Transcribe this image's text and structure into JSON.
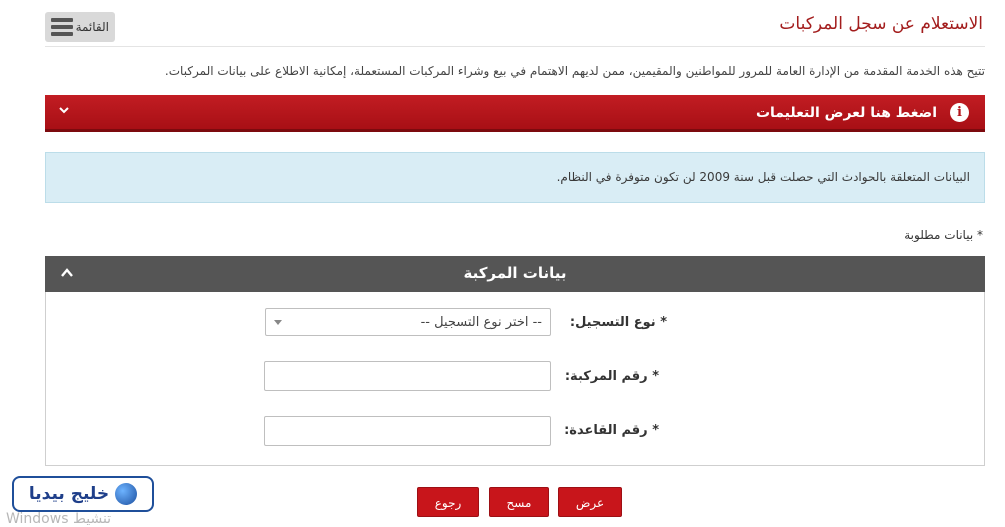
{
  "header": {
    "title": "الاستعلام عن سجل المركبات",
    "menu_label": "القائمة"
  },
  "description": "تتيح هذه الخدمة المقدمة من الإدارة العامة للمرور للمواطنين والمقيمين، ممن لديهم الاهتمام في بيع وشراء المركبات المستعملة، إمكانية الاطلاع على بيانات المركبات.",
  "instructions": {
    "label": "اضغط هنا لعرض التعليمات",
    "info_icon": "i"
  },
  "notice": "البيانات المتعلقة بالحوادث التي حصلت قبل سنة 2009 لن تكون متوفرة في النظام.",
  "required_note": "* بيانات مطلوبة",
  "vehicle_section": {
    "title": "بيانات المركبة",
    "registration_type": {
      "label": "* نوع التسجيل:",
      "selected": "-- اختر نوع التسجيل --"
    },
    "vehicle_number": {
      "label": "* رقم المركبة:",
      "value": ""
    },
    "base_number": {
      "label": "* رقم القاعدة:",
      "value": ""
    }
  },
  "buttons": {
    "view": "عرض",
    "clear": "مسح",
    "back": "رجوع"
  },
  "logo": {
    "name": "خليج بيديا"
  },
  "watermark": "Windows تنشيط",
  "colors": {
    "brand_red": "#c21d23",
    "title_red": "#a31d1d",
    "section_gray": "#555555",
    "notice_blue": "#d9edf5"
  },
  "icons": {
    "menu": "hamburger-icon",
    "instructions": "info-icon",
    "instructions_toggle": "chevron-down-icon",
    "section_toggle": "chevron-up-icon",
    "select_arrow": "caret-down-icon"
  }
}
